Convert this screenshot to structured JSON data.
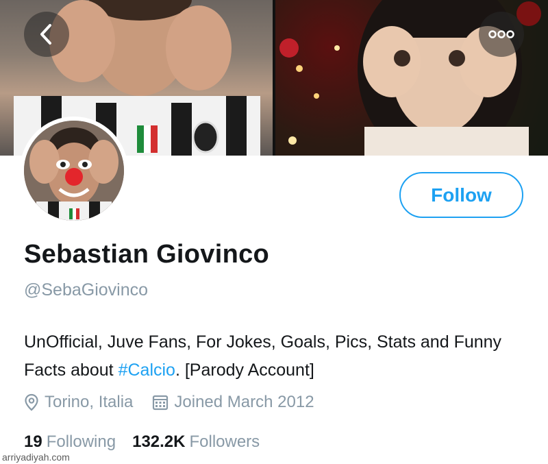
{
  "header": {
    "back_icon": "chevron-left-icon",
    "more_icon": "more-horizontal-icon"
  },
  "profile": {
    "name": "Sebastian Giovinco",
    "handle": "@SebaGiovinco",
    "follow_label": "Follow",
    "bio_text": "UnOfficial, Juve Fans, For Jokes, Goals, Pics, Stats and Funny Facts about ",
    "bio_hashtag": "#Calcio",
    "bio_suffix": ". [Parody Account]",
    "location": "Torino, Italia",
    "joined": "Joined March 2012",
    "following_count": "19",
    "following_label": "Following",
    "followers_count": "132.2K",
    "followers_label": "Followers"
  },
  "watermark": "arriyadiyah.com",
  "colors": {
    "accent": "#1da1f2",
    "secondary_text": "#8899a6",
    "primary_text": "#14171a"
  }
}
